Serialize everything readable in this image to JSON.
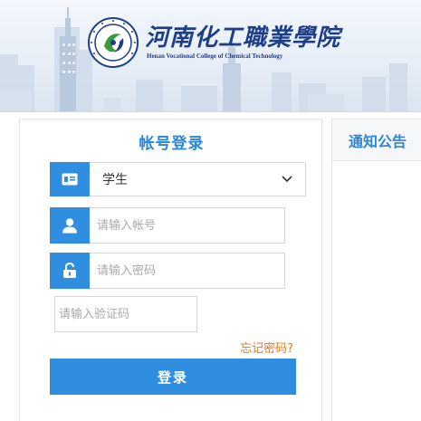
{
  "banner": {
    "school_name_cn": "河南化工職業學院",
    "school_name_en": "Henan Vocational College of Chemical Technology"
  },
  "login": {
    "title": "帐号登录",
    "role_select": {
      "selected": "学生"
    },
    "account_placeholder": "请输入帐号",
    "password_placeholder": "请输入密码",
    "captcha_placeholder": "请输入验证码",
    "forgot_label": "忘记密码?",
    "submit_label": "登录"
  },
  "notice": {
    "title": "通知公告"
  },
  "colors": {
    "primary": "#2f8ee0",
    "title_blue": "#2a86d6",
    "link_orange": "#e07a1c",
    "logo_navy": "#1e3f88"
  },
  "icons": {
    "role": "id-card-icon",
    "account": "user-icon",
    "password": "lock-icon",
    "dropdown": "chevron-down-icon"
  }
}
